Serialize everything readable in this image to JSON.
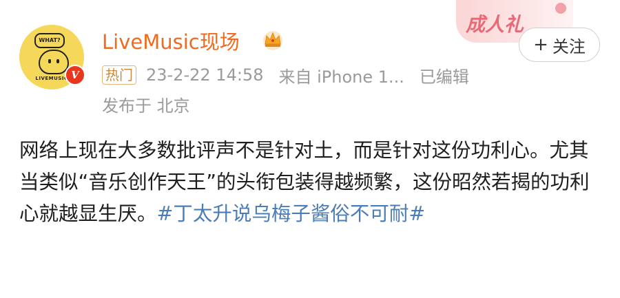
{
  "user": {
    "name": "LiveMusic现场",
    "avatar_caption_bubble": "WHAT?",
    "avatar_caption_brand": "LIVEMUSIC",
    "verified_mark": "V",
    "crown_icon": "crown-icon"
  },
  "meta": {
    "tag": "热门",
    "time": "23-2-22 14:58",
    "source": "来自 iPhone 1...",
    "edited": "已编辑",
    "location": "发布于 北京"
  },
  "header_badge": {
    "text": "成人礼"
  },
  "follow": {
    "plus": "+",
    "label": "关注"
  },
  "post": {
    "text": "网络上现在大多数批评声不是针对土，而是针对这份功利心。尤其当类似“音乐创作天王”的头衔包装得越频繁，这份昭然若揭的功利心就越显生厌。",
    "hashtag": "#丁太升说乌梅子酱俗不可耐#"
  },
  "colors": {
    "username": "#f06b1f",
    "hashtag": "#4a7db8",
    "meta": "#9a9a9a",
    "verified": "#e8361f"
  }
}
